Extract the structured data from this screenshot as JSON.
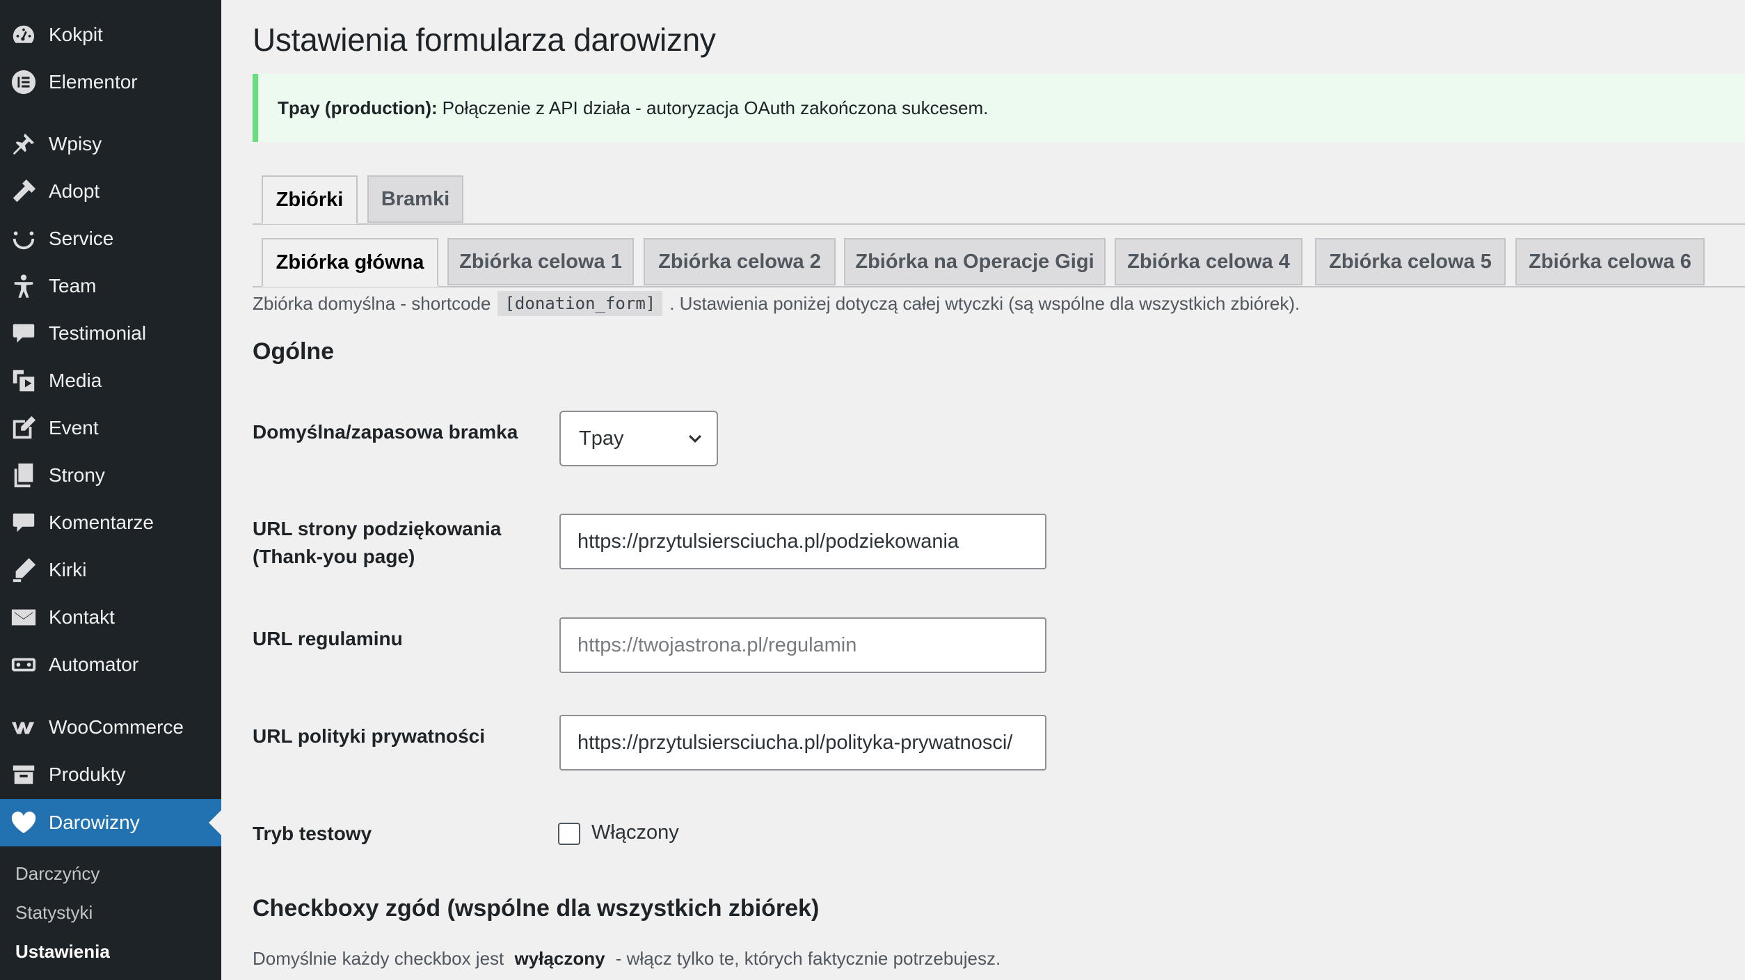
{
  "sidebar": {
    "menu": [
      {
        "label": "Kokpit",
        "icon": "dashboard-icon"
      },
      {
        "label": "Elementor",
        "icon": "elementor-icon"
      },
      {
        "label": "Wpisy",
        "icon": "pin-icon"
      },
      {
        "label": "Adopt",
        "icon": "hammer-icon"
      },
      {
        "label": "Service",
        "icon": "smile-icon"
      },
      {
        "label": "Team",
        "icon": "person-icon"
      },
      {
        "label": "Testimonial",
        "icon": "speech-bubble-icon"
      },
      {
        "label": "Media",
        "icon": "media-icon"
      },
      {
        "label": "Event",
        "icon": "edit-icon"
      },
      {
        "label": "Strony",
        "icon": "pages-icon"
      },
      {
        "label": "Komentarze",
        "icon": "comment-icon"
      },
      {
        "label": "Kirki",
        "icon": "kirki-icon"
      },
      {
        "label": "Kontakt",
        "icon": "mail-icon"
      },
      {
        "label": "Automator",
        "icon": "robot-icon"
      },
      {
        "label": "WooCommerce",
        "icon": "woocommerce-icon"
      },
      {
        "label": "Produkty",
        "icon": "archive-icon"
      },
      {
        "label": "Darowizny",
        "icon": "heart-icon"
      }
    ],
    "submenu": [
      "Darczyńcy",
      "Statystyki",
      "Ustawienia"
    ]
  },
  "page": {
    "title": "Ustawienia formularza darowizny",
    "notice_bold": "Tpay (production):",
    "notice_text": "Połączenie z API działa - autoryzacja OAuth zakończona sukcesem."
  },
  "tabs": {
    "main": [
      "Zbiórki",
      "Bramki"
    ],
    "collections": [
      "Zbiórka główna",
      "Zbiórka celowa 1",
      "Zbiórka celowa 2",
      "Zbiórka na Operacje Gigi",
      "Zbiórka celowa 4",
      "Zbiórka celowa 5",
      "Zbiórka celowa 6"
    ]
  },
  "description": {
    "before": "Zbiórka domyślna - shortcode",
    "code": "[donation_form]",
    "after": ". Ustawienia poniżej dotyczą całej wtyczki (są wspólne dla wszystkich zbiórek)."
  },
  "general": {
    "heading": "Ogólne",
    "gateway_label": "Domyślna/zapasowa bramka",
    "gateway_value": "Tpay",
    "thankyou_label_1": "URL strony podziękowania",
    "thankyou_label_2": "(Thank-you page)",
    "thankyou_value": "https://przytulsiersciucha.pl/podziekowania",
    "terms_label": "URL regulaminu",
    "terms_placeholder": "https://twojastrona.pl/regulamin",
    "privacy_label": "URL polityki prywatności",
    "privacy_value": "https://przytulsiersciucha.pl/polityka-prywatnosci/",
    "test_label": "Tryb testowy",
    "test_checkbox_label": "Włączony"
  },
  "consents": {
    "heading": "Checkboxy zgód (wspólne dla wszystkich zbiórek)",
    "desc_before": "Domyślnie każdy checkbox jest",
    "desc_bold": "wyłączony",
    "desc_after": "- włącz tylko te, których faktycznie potrzebujesz."
  },
  "colors": {
    "sidebar_bg": "#1d2327",
    "accent": "#2271b1",
    "notice_border": "#68de7c",
    "notice_bg": "#edfaef"
  }
}
